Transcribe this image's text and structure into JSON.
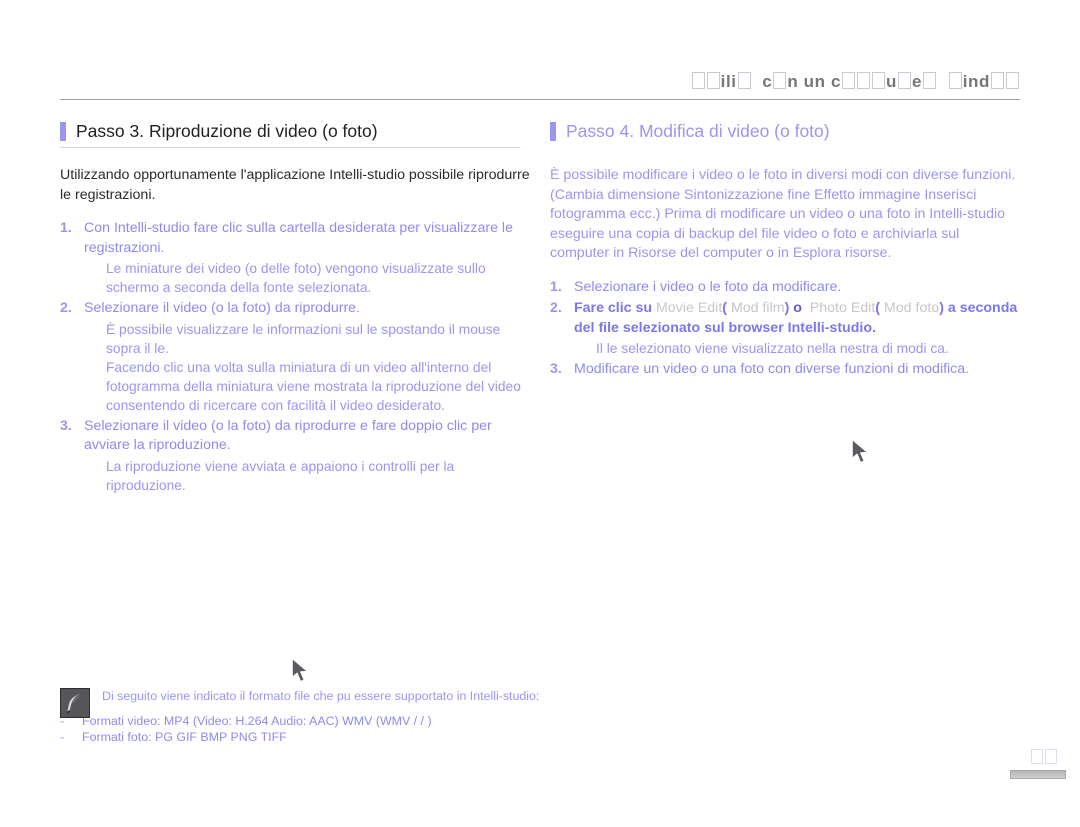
{
  "header": {
    "title_prefix": "",
    "title_parts": [
      "box",
      "box",
      "ili",
      "box",
      " c",
      "box",
      "n un c",
      "box",
      "box",
      "box",
      "u",
      "box",
      "e",
      "box",
      " ",
      "box",
      "ind",
      "box",
      "box"
    ],
    "title_plain": "□□ili□ c□n un c□□□u□e□ □ind□□",
    "rule": true
  },
  "left_column": {
    "heading": "Passo 3. Riproduzione di video (o foto)",
    "intro": "Utilizzando opportunamente l'applicazione Intelli-studio  possibile riprodurre le registrazioni.",
    "steps": [
      {
        "num": "1.",
        "text": "Con Intelli-studio  fare clic sulla cartella desiderata per visualizzare le registrazioni.",
        "sub": "Le miniature dei video (o delle foto) vengono visualizzate sullo schermo  a seconda della fonte selezionata."
      },
      {
        "num": "2.",
        "text": "Selezionare il video (o la foto) da riprodurre.",
        "sub": "È possibile visualizzare le informazioni sul  le spostando il mouse sopra il  le.",
        "sub2": "Facendo clic una volta sulla miniatura di un video  all'interno del fotogramma della miniatura viene mostrata la riproduzione del video  consentendo di ricercare con facilità il video desiderato."
      },
      {
        "num": "3.",
        "text": "Selezionare il video (o la foto) da riprodurre e fare doppio clic per avviare la riproduzione.",
        "sub": "La riproduzione viene avviata e appaiono i controlli per la riproduzione."
      }
    ]
  },
  "right_column": {
    "heading": "Passo 4. Modifica di video (o foto)",
    "intro": "È possibile modificare i video o le foto in diversi modi con diverse funzioni. (Cambia dimensione  Sintonizzazione fine  Effetto immagine  Inserisci fotogramma ecc.) Prima di modificare un video o una foto in Intelli-studio eseguire una copia di backup del file video o foto e archiviarla sul computer in Risorse del computer o in Esplora risorse.",
    "steps": [
      {
        "num": "1.",
        "text": "Selezionare i video o le foto da modificare."
      },
      {
        "num": "2.",
        "lead": "Fare clic su",
        "btn1": "Movie Edit",
        "btn1_alt": "Mod film",
        "separator": "o",
        "btn2": "Photo Edit",
        "btn2_alt": "Mod foto",
        "tail": "a seconda del file selezionato sul browser Intelli-studio.",
        "sub": "Il  le selezionato viene visualizzato nella  nestra di modi ca."
      },
      {
        "num": "3.",
        "text": "Modificare un video o una foto con diverse funzioni di modifica."
      }
    ]
  },
  "note": {
    "icon": "quill-note-icon",
    "text": "Di seguito viene indicato il formato file che pu essere supportato in Intelli-studio:",
    "items": [
      {
        "dash": "-",
        "text": "Formati video: MP4 (Video: H.264  Audio: AAC)  WMV (WMV  / / )"
      },
      {
        "dash": "-",
        "text": "Formati foto:  PG  GIF  BMP  PNG  TIFF"
      }
    ]
  },
  "cursors": [
    {
      "name": "mouse-cursor-left"
    },
    {
      "name": "mouse-cursor-right"
    }
  ],
  "page_number": {
    "plain": "□□"
  },
  "colors": {
    "accent_purple": "#9a96f0",
    "text_dark": "#231f20",
    "muted_gray": "#c6c6cb",
    "header_gray": "#767679"
  }
}
